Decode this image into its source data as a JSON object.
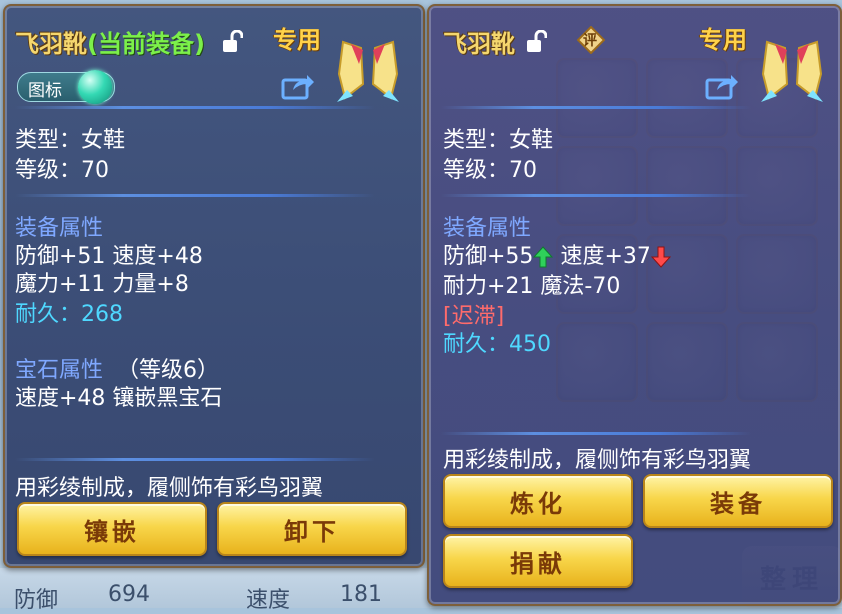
{
  "left_panel": {
    "title": "飞羽靴",
    "title_suffix": "(当前装备)",
    "special_label": "专用",
    "tag_label": "图标",
    "type_line": "类型：女鞋",
    "level_line": "等级：70",
    "attr_header": "装备属性",
    "attr_line1": "防御+51 速度+48",
    "attr_line2": "魔力+11 力量+8",
    "durability_line": "耐久：268",
    "gem_header": "宝石属性",
    "gem_level": "（等级6）",
    "gem_line": "速度+48 镶嵌黑宝石",
    "description": "用彩绫制成，履侧饰有彩鸟羽翼",
    "buttons": [
      "镶嵌",
      "卸下"
    ]
  },
  "right_panel": {
    "title": "飞羽靴",
    "rate_badge": "评",
    "special_label": "专用",
    "type_line": "类型：女鞋",
    "level_line": "等级：70",
    "attr_header": "装备属性",
    "attr_def": "防御+55",
    "attr_spd": "速度+37",
    "attr_line2": "耐力+21 魔法-70",
    "status_tag": "[迟滞]",
    "durability_line": "耐久：450",
    "description": "用彩绫制成，履侧饰有彩鸟羽翼",
    "buttons": [
      "炼化",
      "装备",
      "捐献"
    ]
  },
  "background": {
    "stat_def_label": "防御",
    "stat_def_value": "694",
    "stat_spd_label": "速度",
    "stat_spd_value": "181",
    "sort_button": "整理"
  },
  "colors": {
    "title_gold": "#f5d76e",
    "current_equip_green": "#7cf04a",
    "section_blue": "#7fa8ff",
    "durability_cyan": "#4fd8ff",
    "debuff_red": "#ff6b6b",
    "button_gold": "#f8d64a"
  },
  "icons": {
    "lock": "unlock-icon",
    "share": "share-icon",
    "item": "winged-boots-icon",
    "stat_up": "arrow-up-green-icon",
    "stat_down": "arrow-down-red-icon"
  }
}
